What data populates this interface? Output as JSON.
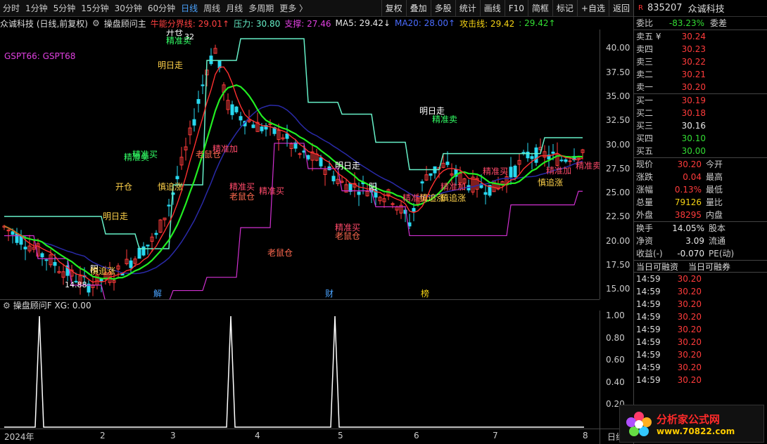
{
  "toolbar": {
    "tabs": [
      "分时",
      "1分钟",
      "5分钟",
      "15分钟",
      "30分钟",
      "60分钟",
      "日线",
      "周线",
      "月线",
      "多周期",
      "更多 〉"
    ],
    "active_tab": "日线",
    "tools": [
      "复权",
      "叠加",
      "多股",
      "统计",
      "画线",
      "F10",
      "简框",
      "标记",
      "+自选",
      "返回"
    ]
  },
  "legend": {
    "stock": "众诚科技 (日线,前复权)",
    "indicator": "操盘顾问主",
    "energy": "牛能分界线: 29.01↑",
    "pressure": "压力: 30.80",
    "support": "支撑: 27.46",
    "ma5": "MA5: 29.42↓",
    "ma20": "MA20: 28.00↑",
    "attack": "攻击线: 29.42",
    "last": ": 29.42↑",
    "gspt": "GSPT66:  GSPT68"
  },
  "main_axis": {
    "ticks": [
      "40.00",
      "37.50",
      "35.00",
      "32.50",
      "30.00",
      "27.50",
      "25.00",
      "22.50",
      "20.00",
      "17.50",
      "15.00"
    ]
  },
  "annotations": {
    "high_price": "32",
    "low_price": "14.88",
    "labels": [
      "开仓",
      "精准卖",
      "明日走",
      "精准买",
      "精准卖",
      "开仓",
      "慎追涨",
      "明日走",
      "老鼠仓",
      "精准加",
      "精准买",
      "老鼠仓",
      "精准买",
      "老鼠仓",
      "明日走",
      "阳",
      "精准买",
      "慎追涨",
      "明日走",
      "精准卖",
      "精准加",
      "慎追涨",
      "精准买",
      "慎追涨",
      "精准加",
      "老鼠仓",
      "精准买",
      "阳",
      "慎追涨",
      "精准卖"
    ],
    "events": [
      "解",
      "财",
      "榜"
    ]
  },
  "sub": {
    "title": "操盘顾问F  XG: 0.00",
    "ticks": [
      "1.00",
      "0.80",
      "0.60",
      "0.40",
      "0.20"
    ]
  },
  "x_axis": {
    "labels": [
      "2024年",
      "2",
      "3",
      "4",
      "5",
      "6",
      "7",
      "8"
    ],
    "corner": "日线"
  },
  "chart_data": {
    "type": "line",
    "ylim": [
      14,
      42
    ],
    "series": [
      {
        "name": "GSPT66",
        "values": []
      },
      {
        "name": "GSPT68",
        "values": []
      }
    ],
    "sub_signal": {
      "values": [
        0,
        1,
        0,
        1,
        0,
        1,
        0
      ],
      "ylim": [
        0,
        1.0
      ]
    }
  },
  "quote": {
    "code": "835207",
    "name": "众诚科技",
    "webi_label": "委比",
    "webi_value": "-83.23%",
    "weicha_label": "委差",
    "asks": [
      {
        "label": "卖五 ¥",
        "price": "30.24"
      },
      {
        "label": "卖四",
        "price": "30.23"
      },
      {
        "label": "卖三",
        "price": "30.22"
      },
      {
        "label": "卖二",
        "price": "30.21"
      },
      {
        "label": "卖一",
        "price": "30.20"
      }
    ],
    "bids": [
      {
        "label": "买一",
        "price": "30.19"
      },
      {
        "label": "买二",
        "price": "30.18"
      },
      {
        "label": "买三",
        "price": "30.16"
      },
      {
        "label": "买四",
        "price": "30.10"
      },
      {
        "label": "买五",
        "price": "30.00"
      }
    ],
    "stats": [
      {
        "l1": "现价",
        "v1": "30.20",
        "l2": "今开",
        "v2": ""
      },
      {
        "l1": "涨跌",
        "v1": "0.04",
        "l2": "最高",
        "v2": ""
      },
      {
        "l1": "涨幅",
        "v1": "0.13%",
        "l2": "最低",
        "v2": ""
      },
      {
        "l1": "总量",
        "v1": "79126",
        "l2": "量比",
        "v2": ""
      },
      {
        "l1": "外盘",
        "v1": "38295",
        "l2": "内盘",
        "v2": ""
      }
    ],
    "stats2": [
      {
        "l1": "换手",
        "v1": "14.05%",
        "l2": "股本"
      },
      {
        "l1": "净资",
        "v1": "3.09",
        "l2": "流通"
      },
      {
        "l1": "收益(-)",
        "v1": "-0.070",
        "l2": "PE(动)"
      }
    ],
    "margin_head": [
      "当日可融资",
      "当日可融券"
    ],
    "ticks": [
      {
        "time": "14:59",
        "price": "30.20"
      },
      {
        "time": "14:59",
        "price": "30.20"
      },
      {
        "time": "14:59",
        "price": "30.20"
      },
      {
        "time": "14:59",
        "price": "30.20"
      },
      {
        "time": "14:59",
        "price": "30.20"
      },
      {
        "time": "14:59",
        "price": "30.20"
      },
      {
        "time": "14:59",
        "price": "30.20"
      },
      {
        "time": "14:59",
        "price": "30.20"
      },
      {
        "time": "14:59",
        "price": "30.20"
      }
    ]
  },
  "watermark": {
    "title": "分析家公式网",
    "url": "www.70822.com"
  },
  "colors": {
    "up": "#ff3b3b",
    "down": "#33dd33",
    "ma_green": "#22ee22",
    "ma_blue": "#2a2aa8",
    "band_cyan": "#66f0c8",
    "band_magenta": "#d030d0",
    "yellow": "#f5d315"
  }
}
